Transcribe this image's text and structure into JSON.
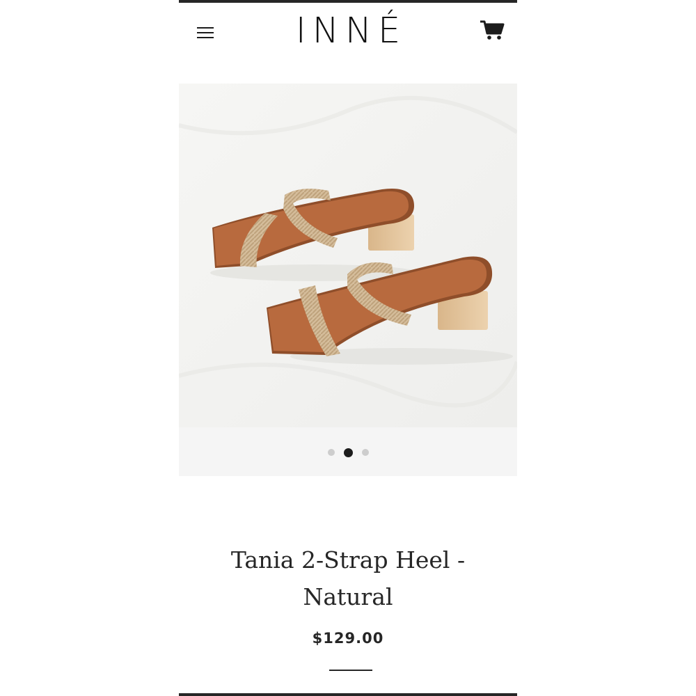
{
  "header": {
    "logo": "INNÉ",
    "menu_icon": "hamburger-menu-icon",
    "cart_icon": "shopping-cart-icon"
  },
  "gallery": {
    "image_alt": "Tania 2-Strap Heel - Natural",
    "slide_count": 3,
    "active_slide_index": 1
  },
  "product": {
    "title": "Tania 2-Strap Heel - Natural",
    "price": "$129.00"
  },
  "colors": {
    "text": "#262626",
    "dot_inactive": "#cdcdcd",
    "dot_active": "#1c1c1c",
    "gallery_bg": "#f5f5f5",
    "leather": "#b86a3e",
    "braid": "#d5bd9b",
    "heel_wood": "#e3c49b"
  }
}
